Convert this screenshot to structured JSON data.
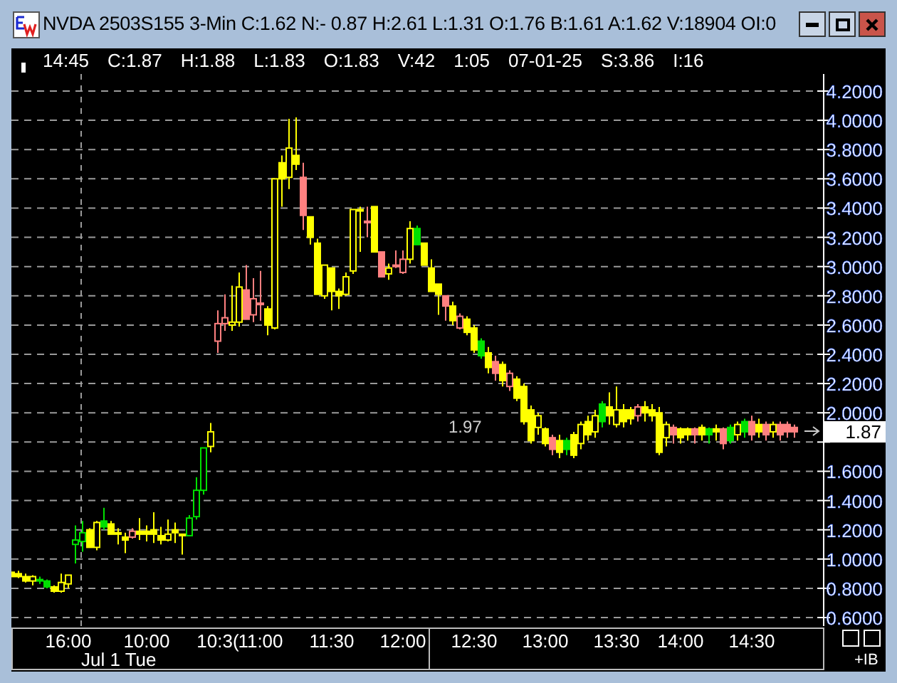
{
  "window": {
    "title": "NVDA 2503S155 3-Min C:1.62 N:- 0.87 H:2.61 L:1.31 O:1.76 B:1.61 A:1.62 V:18904 OI:0"
  },
  "info_line": [
    "14:45",
    "C:1.87",
    "H:1.88",
    "L:1.83",
    "O:1.83",
    "V:42",
    "1:05",
    "07-01-25",
    "S:3.86",
    "I:16"
  ],
  "chart": {
    "chart_data": {
      "type": "candlestick",
      "ylim": [
        0.6,
        4.2
      ],
      "yticks": [
        {
          "value": 4.2,
          "label": "4.2000"
        },
        {
          "value": 4.0,
          "label": "4.0000"
        },
        {
          "value": 3.8,
          "label": "3.8000"
        },
        {
          "value": 3.6,
          "label": "3.6000"
        },
        {
          "value": 3.4,
          "label": "3.4000"
        },
        {
          "value": 3.2,
          "label": "3.2000"
        },
        {
          "value": 3.0,
          "label": "3.0000"
        },
        {
          "value": 2.8,
          "label": "2.8000"
        },
        {
          "value": 2.6,
          "label": "2.6000"
        },
        {
          "value": 2.4,
          "label": "2.4000"
        },
        {
          "value": 2.2,
          "label": "2.2000"
        },
        {
          "value": 2.0,
          "label": "2.0000"
        },
        {
          "value": 1.6,
          "label": "1.6000"
        },
        {
          "value": 1.4,
          "label": "1.4000"
        },
        {
          "value": 1.2,
          "label": "1.2000"
        },
        {
          "value": 1.0,
          "label": "1.0000"
        },
        {
          "value": 0.8,
          "label": "0.8000"
        },
        {
          "value": 0.6,
          "label": "0.6000"
        }
      ],
      "grid": true,
      "categories": [
        null,
        null,
        null,
        null,
        null,
        null,
        null,
        null,
        "16:00",
        null,
        null,
        null,
        null,
        null,
        null,
        null,
        null,
        null,
        null,
        "10:00",
        null,
        null,
        null,
        null,
        null,
        null,
        null,
        null,
        null,
        "10:3(",
        null,
        null,
        null,
        null,
        null,
        "11:00",
        null,
        null,
        null,
        null,
        null,
        null,
        null,
        null,
        null,
        "11:30",
        null,
        null,
        null,
        null,
        null,
        null,
        null,
        null,
        null,
        "12:00",
        null,
        null,
        null,
        null,
        null,
        null,
        null,
        null,
        null,
        "12:30",
        null,
        null,
        null,
        null,
        null,
        null,
        null,
        null,
        null,
        "13:00",
        null,
        null,
        null,
        null,
        null,
        null,
        null,
        null,
        null,
        "13:30",
        null,
        null,
        null,
        null,
        null,
        null,
        null,
        null,
        "14:00",
        null,
        null,
        null,
        null,
        null,
        null,
        null,
        null,
        null,
        "14:30",
        null,
        null,
        null,
        null,
        null,
        null
      ],
      "ohlc": [
        [
          0.91,
          0.91,
          0.88,
          0.88
        ],
        [
          0.9,
          0.92,
          0.87,
          0.88
        ],
        [
          0.88,
          0.9,
          0.84,
          0.85
        ],
        [
          0.85,
          0.89,
          0.82,
          0.88
        ],
        [
          0.86,
          0.88,
          0.83,
          0.85
        ],
        [
          0.85,
          0.86,
          0.8,
          0.81
        ],
        [
          0.81,
          0.82,
          0.77,
          0.78
        ],
        [
          0.78,
          0.9,
          0.77,
          0.84
        ],
        [
          0.83,
          0.89,
          0.8,
          0.89
        ],
        [
          1.1,
          1.23,
          0.97,
          1.13
        ],
        [
          1.12,
          1.26,
          1.05,
          1.18
        ],
        [
          1.2,
          1.21,
          1.08,
          1.08
        ],
        [
          1.08,
          1.26,
          1.06,
          1.25
        ],
        [
          1.26,
          1.35,
          1.2,
          1.22
        ],
        [
          1.24,
          1.26,
          1.17,
          1.17
        ],
        [
          1.18,
          1.21,
          1.1,
          1.17
        ],
        [
          1.15,
          1.18,
          1.04,
          1.13
        ],
        [
          1.15,
          1.21,
          1.14,
          1.19
        ],
        [
          1.19,
          1.28,
          1.13,
          1.17
        ],
        [
          1.19,
          1.23,
          1.12,
          1.17
        ],
        [
          1.2,
          1.32,
          1.11,
          1.17
        ],
        [
          1.16,
          1.22,
          1.1,
          1.13
        ],
        [
          1.13,
          1.27,
          1.12,
          1.17
        ],
        [
          1.2,
          1.25,
          1.11,
          1.18
        ],
        [
          1.17,
          1.17,
          1.03,
          1.16
        ],
        [
          1.16,
          1.3,
          1.16,
          1.28
        ],
        [
          1.29,
          1.56,
          1.27,
          1.47
        ],
        [
          1.47,
          1.76,
          1.44,
          1.76
        ],
        [
          1.77,
          1.93,
          1.73,
          1.87
        ],
        [
          2.49,
          2.7,
          2.41,
          2.61
        ],
        [
          2.61,
          2.81,
          2.56,
          2.65
        ],
        [
          2.6,
          2.87,
          2.56,
          2.62
        ],
        [
          2.62,
          2.96,
          2.59,
          2.86
        ],
        [
          2.84,
          3.01,
          2.64,
          2.64
        ],
        [
          2.67,
          2.92,
          2.62,
          2.78
        ],
        [
          2.75,
          2.97,
          2.63,
          2.74
        ],
        [
          2.71,
          2.73,
          2.53,
          2.6
        ],
        [
          2.58,
          3.6,
          2.57,
          3.6
        ],
        [
          3.71,
          3.76,
          3.41,
          3.6
        ],
        [
          3.61,
          4.01,
          3.53,
          3.81
        ],
        [
          3.76,
          4.02,
          3.66,
          3.7
        ],
        [
          3.61,
          3.71,
          3.25,
          3.35
        ],
        [
          3.34,
          3.34,
          3.15,
          3.2
        ],
        [
          3.16,
          3.19,
          2.81,
          2.81
        ],
        [
          2.8,
          3.01,
          2.78,
          3.01
        ],
        [
          2.99,
          2.99,
          2.7,
          2.83
        ],
        [
          2.83,
          2.85,
          2.71,
          2.8
        ],
        [
          2.81,
          2.96,
          2.8,
          2.93
        ],
        [
          2.97,
          3.39,
          2.95,
          3.39
        ],
        [
          3.39,
          3.41,
          3.1,
          3.38
        ],
        [
          3.31,
          3.41,
          3.2,
          3.3
        ],
        [
          3.41,
          3.41,
          3.1,
          3.1
        ],
        [
          3.1,
          3.1,
          2.93,
          2.93
        ],
        [
          2.95,
          3.02,
          2.91,
          2.99
        ],
        [
          3.01,
          3.11,
          2.99,
          3.0
        ],
        [
          2.96,
          3.11,
          2.95,
          3.05
        ],
        [
          3.05,
          3.31,
          3.02,
          3.26
        ],
        [
          3.26,
          3.28,
          3.15,
          3.15
        ],
        [
          3.16,
          3.16,
          3.01,
          3.01
        ],
        [
          2.99,
          3.05,
          2.83,
          2.83
        ],
        [
          2.88,
          2.88,
          2.67,
          2.81
        ],
        [
          2.8,
          2.8,
          2.63,
          2.73
        ],
        [
          2.73,
          2.76,
          2.6,
          2.63
        ],
        [
          2.58,
          2.68,
          2.57,
          2.66
        ],
        [
          2.64,
          2.66,
          2.53,
          2.55
        ],
        [
          2.58,
          2.6,
          2.41,
          2.43
        ],
        [
          2.49,
          2.51,
          2.37,
          2.39
        ],
        [
          2.41,
          2.45,
          2.27,
          2.31
        ],
        [
          2.35,
          2.39,
          2.22,
          2.27
        ],
        [
          2.33,
          2.35,
          2.18,
          2.22
        ],
        [
          2.18,
          2.29,
          2.15,
          2.27
        ],
        [
          2.23,
          2.25,
          2.08,
          2.1
        ],
        [
          2.18,
          2.2,
          1.92,
          1.94
        ],
        [
          2.02,
          2.05,
          1.79,
          1.81
        ],
        [
          1.9,
          2.0,
          1.85,
          1.98
        ],
        [
          1.89,
          1.9,
          1.77,
          1.79
        ],
        [
          1.83,
          1.85,
          1.71,
          1.75
        ],
        [
          1.81,
          1.85,
          1.69,
          1.73
        ],
        [
          1.81,
          1.83,
          1.71,
          1.75
        ],
        [
          1.85,
          1.87,
          1.69,
          1.71
        ],
        [
          1.79,
          1.94,
          1.75,
          1.92
        ],
        [
          1.94,
          1.98,
          1.81,
          1.85
        ],
        [
          1.87,
          2.02,
          1.83,
          1.98
        ],
        [
          2.06,
          2.08,
          1.9,
          1.94
        ],
        [
          2.04,
          2.14,
          1.92,
          1.98
        ],
        [
          1.92,
          2.18,
          1.9,
          2.02
        ],
        [
          2.02,
          2.06,
          1.9,
          1.94
        ],
        [
          2.02,
          2.04,
          1.92,
          1.96
        ],
        [
          1.98,
          2.06,
          1.94,
          2.04
        ],
        [
          2.04,
          2.08,
          1.94,
          2.0
        ],
        [
          2.02,
          2.06,
          1.94,
          1.98
        ],
        [
          2.0,
          2.04,
          1.71,
          1.73
        ],
        [
          1.83,
          1.94,
          1.77,
          1.92
        ],
        [
          1.9,
          1.92,
          1.79,
          1.85
        ],
        [
          1.89,
          1.9,
          1.79,
          1.83
        ],
        [
          1.89,
          1.9,
          1.81,
          1.85
        ],
        [
          1.89,
          1.9,
          1.79,
          1.85
        ],
        [
          1.9,
          1.92,
          1.81,
          1.85
        ],
        [
          1.89,
          1.9,
          1.79,
          1.85
        ],
        [
          1.89,
          1.92,
          1.81,
          1.87
        ],
        [
          1.89,
          1.9,
          1.75,
          1.79
        ],
        [
          1.9,
          1.92,
          1.79,
          1.81
        ],
        [
          1.85,
          1.94,
          1.81,
          1.92
        ],
        [
          1.94,
          1.96,
          1.83,
          1.87
        ],
        [
          1.94,
          1.98,
          1.81,
          1.85
        ],
        [
          1.92,
          1.96,
          1.83,
          1.87
        ],
        [
          1.92,
          1.94,
          1.81,
          1.85
        ],
        [
          1.87,
          1.94,
          1.83,
          1.92
        ],
        [
          1.92,
          1.94,
          1.81,
          1.85
        ],
        [
          1.92,
          1.94,
          1.83,
          1.87
        ],
        [
          1.9,
          1.92,
          1.83,
          1.87
        ]
      ],
      "colors": [
        "#ffff00",
        "#ffff00",
        "#ffff00",
        "#ffff00",
        "#00e000",
        "#00e000",
        "#ffff00",
        "#ffff00",
        "#ffff00",
        "#00e000",
        "#00e000",
        "#ffff00",
        "#ffff00",
        "#00e000",
        "#ffff00",
        "#ffff00",
        "#ffff00",
        "#ff8080",
        "#ffff00",
        "#ffff00",
        "#ffff00",
        "#ffff00",
        "#ffff00",
        "#ffff00",
        "#ffff00",
        "#00e000",
        "#00e000",
        "#00e000",
        "#ffff00",
        "#ff8080",
        "#ff8080",
        "#ffff00",
        "#ffff00",
        "#ff8080",
        "#ff8080",
        "#ff8080",
        "#ffff00",
        "#ffff00",
        "#ffff00",
        "#ffff00",
        "#ffff00",
        "#ff8080",
        "#ffff00",
        "#ffff00",
        "#ffff00",
        "#ffff00",
        "#ffff00",
        "#ffff00",
        "#ffff00",
        "#ffff00",
        "#ff8080",
        "#ffff00",
        "#ff8080",
        "#ffff00",
        "#ff8080",
        "#ff8080",
        "#ffff00",
        "#00e000",
        "#ffff00",
        "#ffff00",
        "#ffff00",
        "#ff8080",
        "#ffff00",
        "#ff8080",
        "#ffff00",
        "#ffff00",
        "#00e000",
        "#ffff00",
        "#ff8080",
        "#ffff00",
        "#ff8080",
        "#ffff00",
        "#ffff00",
        "#ffff00",
        "#ffff00",
        "#ffff00",
        "#ff8080",
        "#ffff00",
        "#00e000",
        "#ffff00",
        "#ffff00",
        "#ffff00",
        "#ffff00",
        "#00e000",
        "#ffff00",
        "#ffff00",
        "#ffff00",
        "#ffff00",
        "#ff8080",
        "#ffff00",
        "#ffff00",
        "#ffff00",
        "#ffff00",
        "#ff8080",
        "#ffff00",
        "#ffff00",
        "#ff8080",
        "#ffff00",
        "#00e000",
        "#ffff00",
        "#ff8080",
        "#00e000",
        "#ffff00",
        "#00e000",
        "#ff8080",
        "#ffff00",
        "#ff8080",
        "#ffff00",
        "#ff8080",
        "#ff8080",
        "#ff8080"
      ]
    },
    "current_price": "1.87",
    "chart_note": "1.97",
    "date_label": "Jul 1 Tue",
    "corner_label": "+IB"
  }
}
